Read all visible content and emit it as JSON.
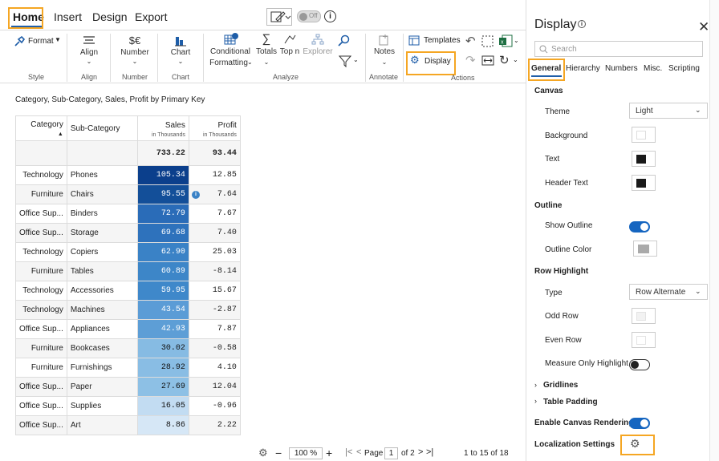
{
  "ribbon": {
    "tabs": [
      "Home",
      "Insert",
      "Design",
      "Export"
    ],
    "toggle_label": "Off",
    "buttons": {
      "format": "Format",
      "align": "Align",
      "number_symbol": "$€",
      "number": "Number",
      "chart": "Chart",
      "conditional": "Conditional",
      "formatting": "Formatting",
      "totals": "Totals",
      "topn": "Top n",
      "explorer": "Explorer",
      "notes": "Notes",
      "templates": "Templates",
      "display": "Display"
    },
    "groups": [
      "Style",
      "Align",
      "Number",
      "Chart",
      "Analyze",
      "Annotate",
      "Actions"
    ]
  },
  "grid": {
    "caption": "Category, Sub-Category, Sales, Profit by Primary Key",
    "headers": {
      "category": "Category",
      "subcategory": "Sub-Category",
      "sales": "Sales",
      "sales_unit": "in Thousands",
      "profit": "Profit",
      "profit_unit": "in Thousands"
    },
    "totals": {
      "sales": "733.22",
      "profit": "93.44"
    },
    "rows": [
      {
        "cat": "Technology",
        "sub": "Phones",
        "sales": "105.34",
        "profit": "12.85",
        "color": "#0b3f8c"
      },
      {
        "cat": "Furniture",
        "sub": "Chairs",
        "sales": "95.55",
        "profit": "7.64",
        "color": "#134f99"
      },
      {
        "cat": "Office Sup...",
        "sub": "Binders",
        "sales": "72.79",
        "profit": "7.67",
        "color": "#2a6cb8"
      },
      {
        "cat": "Office Sup...",
        "sub": "Storage",
        "sales": "69.68",
        "profit": "7.40",
        "color": "#2e72bc"
      },
      {
        "cat": "Technology",
        "sub": "Copiers",
        "sales": "62.90",
        "profit": "25.03",
        "color": "#3a82c6"
      },
      {
        "cat": "Furniture",
        "sub": "Tables",
        "sales": "60.89",
        "profit": "-8.14",
        "color": "#3d86c8"
      },
      {
        "cat": "Technology",
        "sub": "Accessories",
        "sales": "59.95",
        "profit": "15.67",
        "color": "#3f88ca"
      },
      {
        "cat": "Technology",
        "sub": "Machines",
        "sales": "43.54",
        "profit": "-2.87",
        "color": "#5b9cd6"
      },
      {
        "cat": "Office Sup...",
        "sub": "Appliances",
        "sales": "42.93",
        "profit": "7.87",
        "color": "#5d9ed6"
      },
      {
        "cat": "Furniture",
        "sub": "Bookcases",
        "sales": "30.02",
        "profit": "-0.58",
        "color": "#86bbe3"
      },
      {
        "cat": "Furniture",
        "sub": "Furnishings",
        "sales": "28.92",
        "profit": "4.10",
        "color": "#89bde4"
      },
      {
        "cat": "Office Sup...",
        "sub": "Paper",
        "sales": "27.69",
        "profit": "12.04",
        "color": "#8dc0e5"
      },
      {
        "cat": "Office Sup...",
        "sub": "Supplies",
        "sales": "16.05",
        "profit": "-0.96",
        "color": "#c2dcf2"
      },
      {
        "cat": "Office Sup...",
        "sub": "Art",
        "sales": "8.86",
        "profit": "2.22",
        "color": "#d6e7f6"
      }
    ]
  },
  "footer": {
    "zoom": "100 %",
    "page_label": "Page",
    "page_value": "1",
    "page_of": "of 2",
    "range": "1 to 15 of 18"
  },
  "panel": {
    "title": "Display",
    "search_placeholder": "Search",
    "tabs": [
      "General",
      "Hierarchy",
      "Numbers",
      "Misc.",
      "Scripting"
    ],
    "canvas_header": "Canvas",
    "theme_label": "Theme",
    "theme_value": "Light",
    "background_label": "Background",
    "text_label": "Text",
    "header_text_label": "Header Text",
    "outline_header": "Outline",
    "show_outline_label": "Show Outline",
    "outline_color_label": "Outline Color",
    "row_highlight_header": "Row Highlight",
    "type_label": "Type",
    "type_value": "Row Alternate",
    "odd_row_label": "Odd Row",
    "even_row_label": "Even Row",
    "measure_only_label": "Measure Only Highlight",
    "gridlines_label": "Gridlines",
    "table_padding_label": "Table Padding",
    "canvas_rendering_label": "Enable Canvas Rendering",
    "localization_label": "Localization Settings"
  },
  "colors": {
    "accent": "#1f5ea8",
    "highlight": "#f5a623",
    "toggle_on": "#1565c0"
  }
}
